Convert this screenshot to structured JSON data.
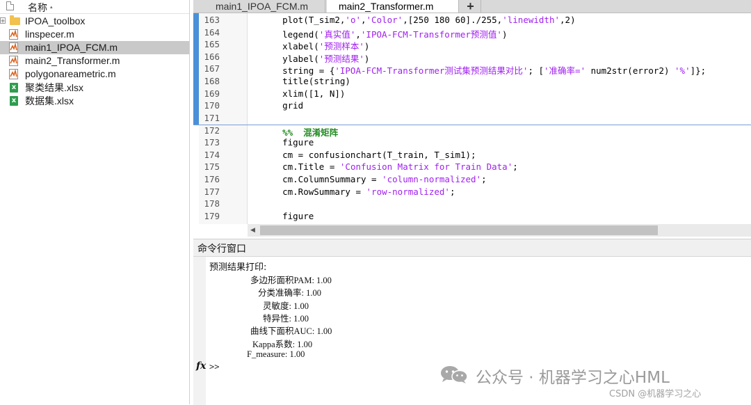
{
  "file_browser": {
    "header_label": "名称",
    "sort_indicator": "▴",
    "items": [
      {
        "name": "IPOA_toolbox",
        "type": "folder",
        "expander": "+"
      },
      {
        "name": "linspecer.m",
        "type": "m-file"
      },
      {
        "name": "main1_IPOA_FCM.m",
        "type": "m-file",
        "selected": true
      },
      {
        "name": "main2_Transformer.m",
        "type": "m-file"
      },
      {
        "name": "polygonareametric.m",
        "type": "m-file"
      },
      {
        "name": "聚类结果.xlsx",
        "type": "xlsx"
      },
      {
        "name": "数据集.xlsx",
        "type": "xlsx"
      }
    ]
  },
  "editor": {
    "tabs": [
      {
        "label": "main1_IPOA_FCM.m",
        "active": false
      },
      {
        "label": "main2_Transformer.m",
        "active": true
      }
    ],
    "add_tab_label": "+",
    "lines": [
      {
        "n": "163",
        "code": "    plot(T_sim2,'o','Color',[250 180 60]./255,'linewidth',2)"
      },
      {
        "n": "164",
        "code": "    legend('真实值','IPOA-FCM-Transformer预测值')"
      },
      {
        "n": "165",
        "code": "    xlabel('预测样本')"
      },
      {
        "n": "166",
        "code": "    ylabel('预测结果')"
      },
      {
        "n": "167",
        "code": "    string = {'IPOA-FCM-Transformer测试集预测结果对比'; ['准确率=' num2str(error2) '%']};"
      },
      {
        "n": "168",
        "code": "    title(string)"
      },
      {
        "n": "169",
        "code": "    xlim([1, N])"
      },
      {
        "n": "170",
        "code": "    grid"
      },
      {
        "n": "171",
        "code": ""
      },
      {
        "n": "172",
        "code": "    %%  混淆矩阵"
      },
      {
        "n": "173",
        "code": "    figure"
      },
      {
        "n": "174",
        "code": "    cm = confusionchart(T_train, T_sim1);"
      },
      {
        "n": "175",
        "code": "    cm.Title = 'Confusion Matrix for Train Data';"
      },
      {
        "n": "176",
        "code": "    cm.ColumnSummary = 'column-normalized';"
      },
      {
        "n": "177",
        "code": "    cm.RowSummary = 'row-normalized';"
      },
      {
        "n": "178",
        "code": ""
      },
      {
        "n": "179",
        "code": "    figure"
      }
    ]
  },
  "command_window": {
    "title": "命令行窗口",
    "output": [
      "预测结果打印:",
      "多边形面积PAM: 1.00",
      "分类准确率: 1.00",
      "灵敏度: 1.00",
      "特异性: 1.00",
      "曲线下面积AUC: 1.00",
      "Kappa系数: 1.00",
      "F_measure: 1.00"
    ],
    "fx_label": "fx",
    "prompt": ">>"
  },
  "watermark": {
    "main": "公众号 · 机器学习之心HML",
    "csdn": "CSDN @机器学习之心"
  },
  "colors": {
    "string": "#a020f0",
    "comment": "#228b22",
    "selection": "#c9c9c9",
    "section_bar": "#4a90d9"
  }
}
